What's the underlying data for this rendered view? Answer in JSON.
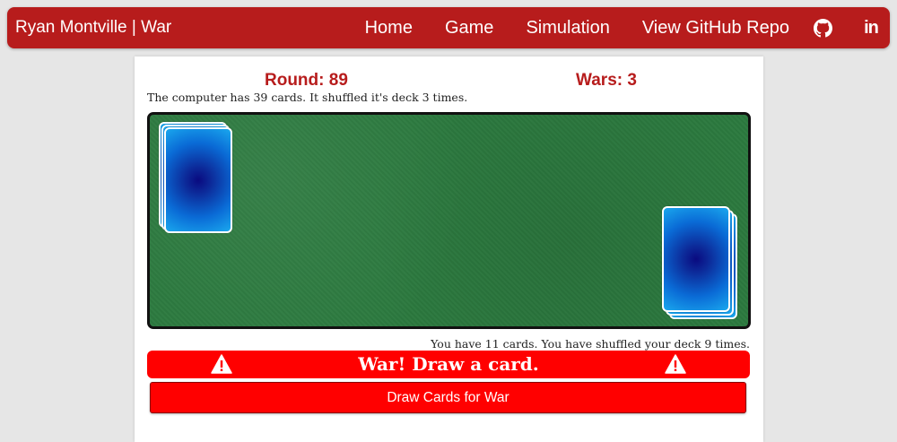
{
  "nav": {
    "brand": "Ryan Montville | War",
    "links": [
      "Home",
      "Game",
      "Simulation",
      "View GitHub Repo"
    ],
    "icons": [
      "github-icon",
      "linkedin-icon"
    ],
    "linkedin_glyph": "in"
  },
  "game": {
    "round_label": "Round: 89",
    "wars_label": "Wars: 3",
    "computer_status": "The computer has 39 cards. It shuffled it's deck 3 times.",
    "player_status": "You have 11 cards. You have shuffled your deck 9 times.",
    "alert_text": "War! Draw a card.",
    "draw_button_label": "Draw Cards for War"
  },
  "colors": {
    "brand_red": "#b71c1c",
    "alert_red": "#ff0000",
    "table_green": "#2c7a3f",
    "card_blue": "#0a6bd6"
  }
}
